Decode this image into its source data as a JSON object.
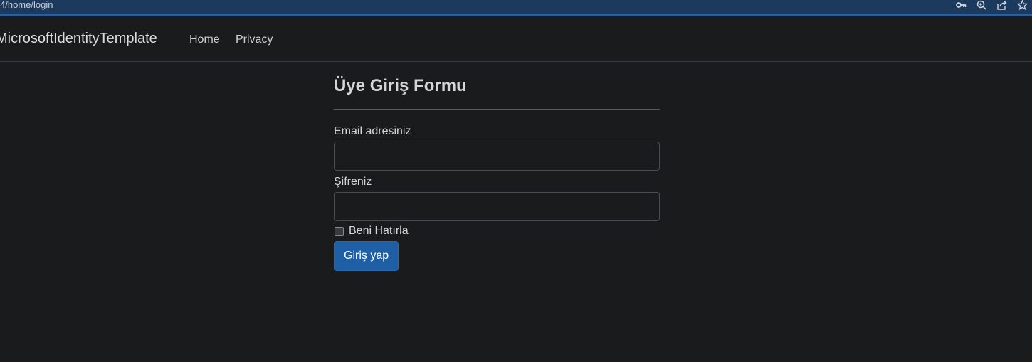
{
  "browser": {
    "url": "4/home/login",
    "icons": [
      "key-icon",
      "zoom-icon",
      "share-icon",
      "star-icon"
    ]
  },
  "navbar": {
    "brand": "MicrosoftIdentityTemplate",
    "links": [
      {
        "label": "Home"
      },
      {
        "label": "Privacy"
      }
    ]
  },
  "form": {
    "title": "Üye Giriş Formu",
    "email_label": "Email adresiniz",
    "email_value": "",
    "password_label": "Şifreniz",
    "password_value": "",
    "remember_label": "Beni Hatırla",
    "remember_checked": false,
    "submit_label": "Giriş yap"
  },
  "colors": {
    "background": "#1a1b1d",
    "browser_bar": "#1c3a5e",
    "primary_button": "#1f5fa6"
  }
}
